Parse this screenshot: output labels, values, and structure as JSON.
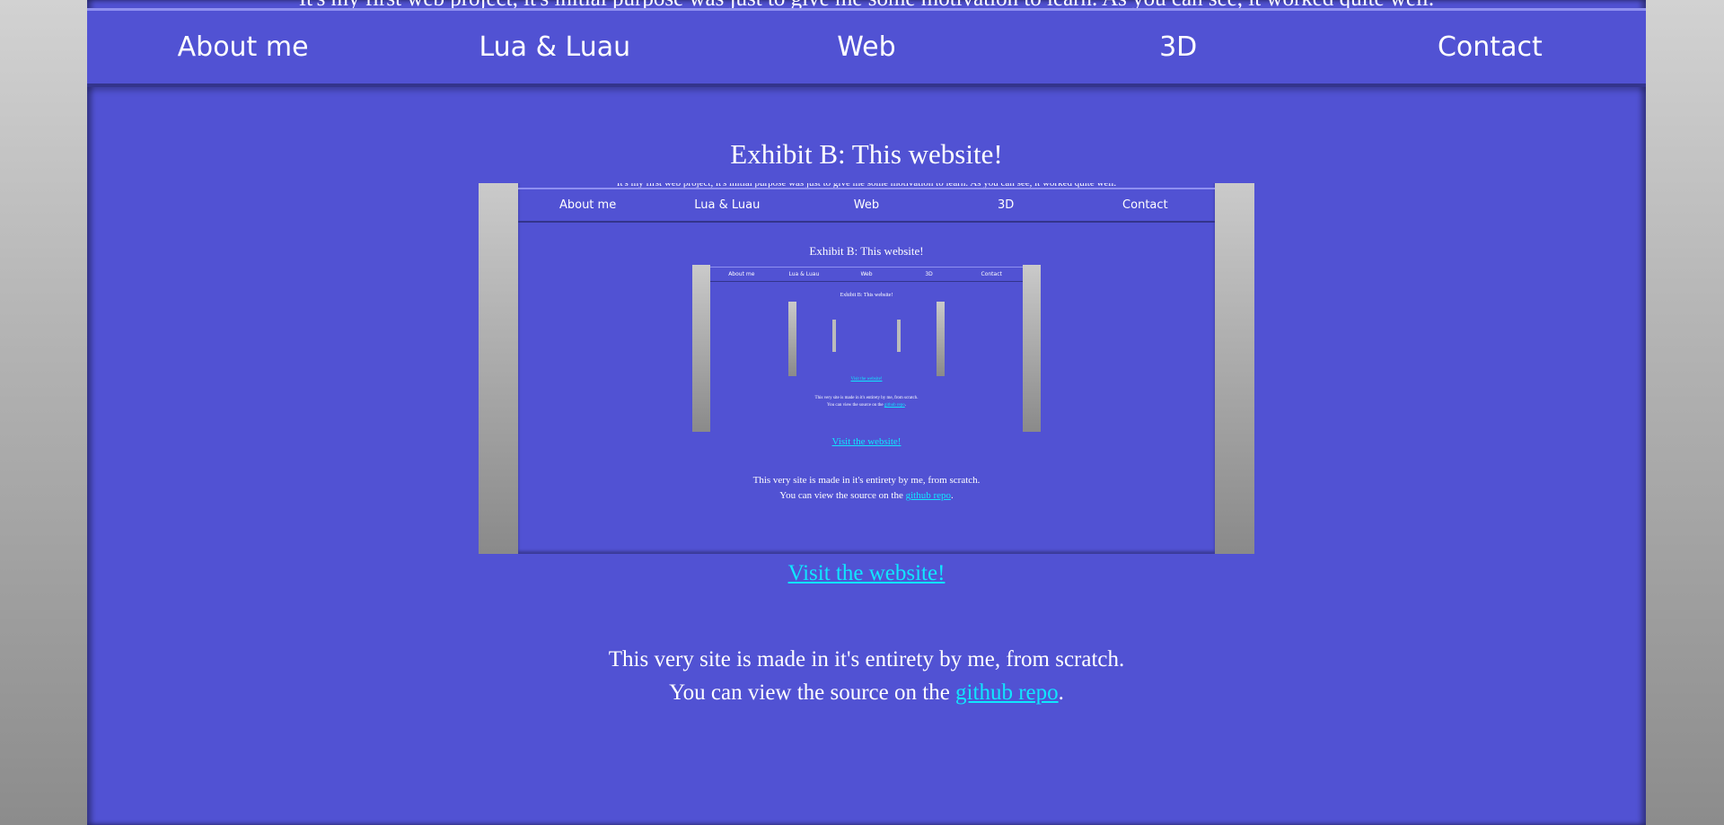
{
  "intro_text": "It's my first web project, it's initial purpose was just to give me some motivation to learn. As you can see, it worked quite well.",
  "nav": {
    "items": [
      "About me",
      "Lua & Luau",
      "Web",
      "3D",
      "Contact"
    ]
  },
  "exhibit": {
    "title": "Exhibit B: This website!",
    "visit_link": "Visit the website!",
    "description_line1": "This very site is made in it's entirety by me, from scratch.",
    "description_line2_prefix": "You can view the source on the ",
    "repo_link": "github repo",
    "description_line2_suffix": "."
  },
  "colors": {
    "page_bg": "#5152d3",
    "link": "#10e6ff",
    "text": "#ffffff"
  }
}
